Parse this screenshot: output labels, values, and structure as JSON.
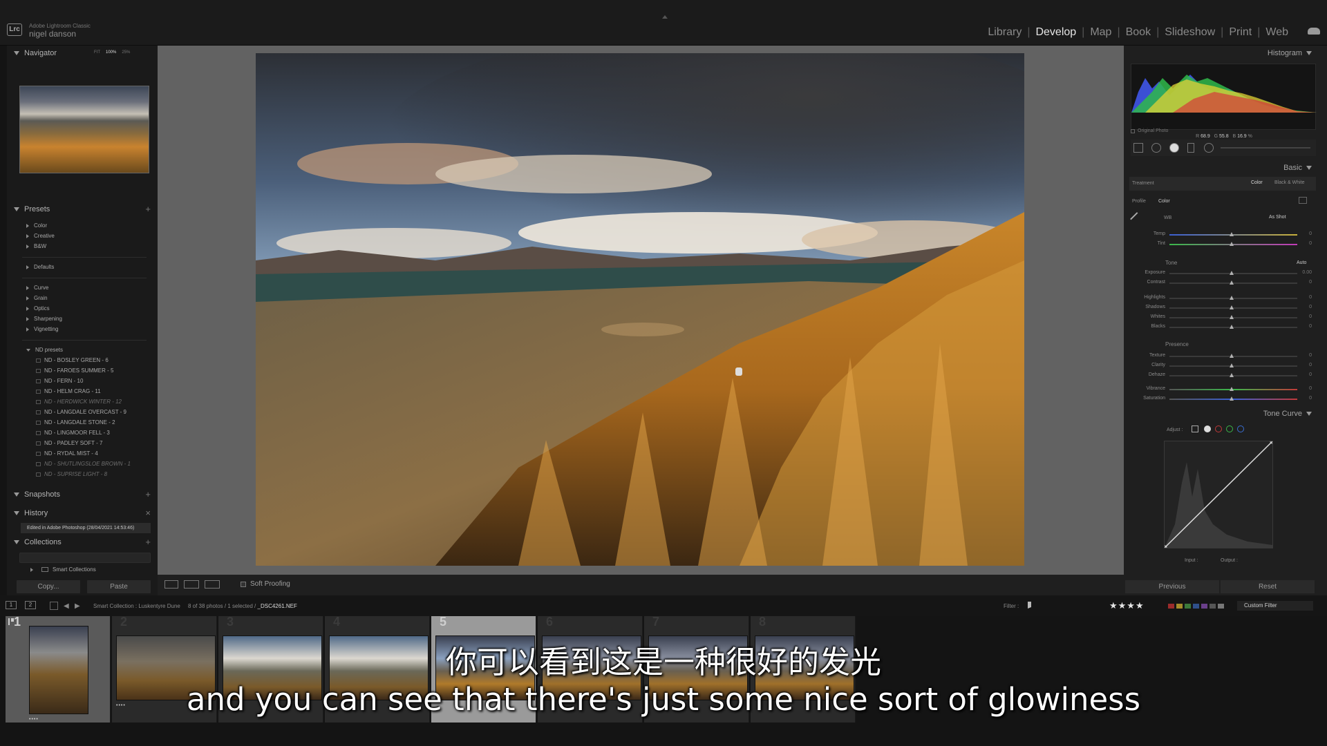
{
  "app": {
    "badge": "Lrc",
    "name": "Adobe Lightroom Classic",
    "user": "nigel danson"
  },
  "modules": [
    "Library",
    "Develop",
    "Map",
    "Book",
    "Slideshow",
    "Print",
    "Web"
  ],
  "active_module": "Develop",
  "left_panel": {
    "navigator": {
      "title": "Navigator",
      "zoom": [
        "FIT",
        "100%",
        "25%"
      ]
    },
    "presets": {
      "title": "Presets",
      "groups": [
        "Color",
        "Creative",
        "B&W",
        "Defaults",
        "Curve",
        "Grain",
        "Optics",
        "Sharpening",
        "Vignetting"
      ],
      "nd_group": "ND presets",
      "nd_items": [
        "ND - BOSLEY GREEN - 6",
        "ND - FAROES SUMMER - 5",
        "ND - FERN - 10",
        "ND - HELM CRAG - 11",
        "ND - HERDWICK WINTER - 12",
        "ND - LANGDALE OVERCAST - 9",
        "ND - LANGDALE STONE - 2",
        "ND - LINGMOOR FELL - 3",
        "ND - PADLEY SOFT - 7",
        "ND - RYDAL MIST - 4",
        "ND - SHUTLINGSLOE BROWN - 1",
        "ND - SUPRISE LIGHT - 8"
      ]
    },
    "snapshots": "Snapshots",
    "history": {
      "title": "History",
      "entry": "Edited in Adobe Photoshop (28/04/2021 14:53:46)"
    },
    "collections": {
      "title": "Collections",
      "item": "Smart Collections"
    },
    "copy_label": "Copy...",
    "paste_label": "Paste"
  },
  "toolbar": {
    "soft_proofing": "Soft Proofing"
  },
  "right_panel": {
    "histogram": "Histogram",
    "rgb": {
      "r_label": "R",
      "r": "68.9",
      "g_label": "G",
      "g": "55.8",
      "b_label": "B",
      "b": "16.9",
      "unit": "%"
    },
    "original_photo": "Original Photo",
    "basic": "Basic",
    "treatment": {
      "label": "Treatment",
      "color": "Color",
      "bw": "Black & White"
    },
    "profile": {
      "label": "Profile",
      "value": "Color"
    },
    "wb": {
      "label": "WB",
      "value": "As Shot"
    },
    "wb_sliders": [
      {
        "label": "Temp",
        "value": "0"
      },
      {
        "label": "Tint",
        "value": "0"
      }
    ],
    "tone": {
      "label": "Tone",
      "auto": "Auto"
    },
    "tone_sliders": [
      {
        "label": "Exposure",
        "value": "0.00"
      },
      {
        "label": "Contrast",
        "value": "0"
      },
      {
        "label": "Highlights",
        "value": "0"
      },
      {
        "label": "Shadows",
        "value": "0"
      },
      {
        "label": "Whites",
        "value": "0"
      },
      {
        "label": "Blacks",
        "value": "0"
      }
    ],
    "presence": "Presence",
    "presence_sliders": [
      {
        "label": "Texture",
        "value": "0"
      },
      {
        "label": "Clarity",
        "value": "0"
      },
      {
        "label": "Dehaze",
        "value": "0"
      },
      {
        "label": "Vibrance",
        "value": "0"
      },
      {
        "label": "Saturation",
        "value": "0"
      }
    ],
    "tone_curve": "Tone Curve",
    "adjust": "Adjust :",
    "input": "Input :",
    "output": "Output :",
    "previous": "Previous",
    "reset": "Reset"
  },
  "filmstrip_bar": {
    "source": "Smart Collection : Luskentyre Dune",
    "count": "8 of 38 photos / 1 selected /",
    "selected_file": "_DSC4261.NEF",
    "filter_label": "Filter :",
    "stars": "★★★★",
    "custom_filter": "Custom Filter",
    "label_colors": [
      "#9b2b2b",
      "#a58c2a",
      "#3c7a3a",
      "#2f4f8a",
      "#6a3f8a",
      "#555555",
      "#777777"
    ]
  },
  "filmstrip": {
    "numbers": [
      "1",
      "2",
      "3",
      "4",
      "5",
      "6",
      "7",
      "8"
    ],
    "selected_index": 5
  },
  "subtitles": {
    "zh": "你可以看到这是一种很好的发光",
    "en": "and you can see that there's just some nice sort of glowiness"
  }
}
